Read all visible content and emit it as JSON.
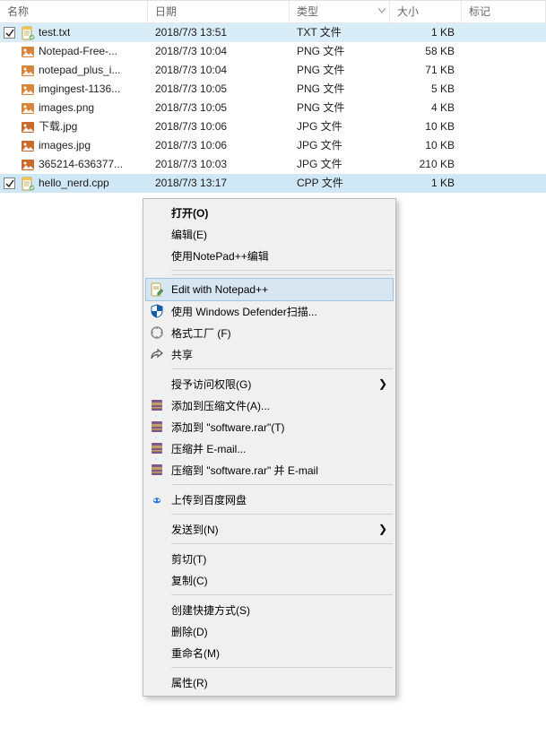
{
  "header": {
    "columns": {
      "name": "名称",
      "date": "日期",
      "type": "类型",
      "size": "大小",
      "tags": "标记"
    }
  },
  "files": [
    {
      "selected": true,
      "icon": "txt",
      "name": "test.txt",
      "date": "2018/7/3 13:51",
      "type": "TXT 文件",
      "size": "1 KB"
    },
    {
      "selected": false,
      "icon": "png",
      "name": "Notepad-Free-...",
      "date": "2018/7/3 10:04",
      "type": "PNG 文件",
      "size": "58 KB"
    },
    {
      "selected": false,
      "icon": "png",
      "name": "notepad_plus_i...",
      "date": "2018/7/3 10:04",
      "type": "PNG 文件",
      "size": "71 KB"
    },
    {
      "selected": false,
      "icon": "png",
      "name": "imgingest-1136...",
      "date": "2018/7/3 10:05",
      "type": "PNG 文件",
      "size": "5 KB"
    },
    {
      "selected": false,
      "icon": "png",
      "name": "images.png",
      "date": "2018/7/3 10:05",
      "type": "PNG 文件",
      "size": "4 KB"
    },
    {
      "selected": false,
      "icon": "jpg",
      "name": "下载.jpg",
      "date": "2018/7/3 10:06",
      "type": "JPG 文件",
      "size": "10 KB"
    },
    {
      "selected": false,
      "icon": "jpg",
      "name": "images.jpg",
      "date": "2018/7/3 10:06",
      "type": "JPG 文件",
      "size": "10 KB"
    },
    {
      "selected": false,
      "icon": "jpg",
      "name": "365214-636377...",
      "date": "2018/7/3 10:03",
      "type": "JPG 文件",
      "size": "210 KB"
    },
    {
      "selected": true,
      "icon": "cpp",
      "name": "hello_nerd.cpp",
      "date": "2018/7/3 13:17",
      "type": "CPP 文件",
      "size": "1 KB"
    }
  ],
  "context_menu": {
    "items": [
      {
        "kind": "item",
        "icon": "none",
        "label": "打开(O)",
        "default": true
      },
      {
        "kind": "item",
        "icon": "none",
        "label": "编辑(E)"
      },
      {
        "kind": "item",
        "icon": "none",
        "label": "使用NotePad++编辑"
      },
      {
        "kind": "sep"
      },
      {
        "kind": "sep"
      },
      {
        "kind": "item",
        "icon": "npp",
        "label": "Edit with Notepad++",
        "highlight": true
      },
      {
        "kind": "item",
        "icon": "defender",
        "label": "使用 Windows Defender扫描..."
      },
      {
        "kind": "item",
        "icon": "format",
        "label": "格式工厂 (F)"
      },
      {
        "kind": "item",
        "icon": "share",
        "label": "共享"
      },
      {
        "kind": "sep"
      },
      {
        "kind": "item",
        "icon": "none",
        "label": "授予访问权限(G)",
        "submenu": true
      },
      {
        "kind": "item",
        "icon": "rar",
        "label": "添加到压缩文件(A)..."
      },
      {
        "kind": "item",
        "icon": "rar",
        "label": "添加到 \"software.rar\"(T)"
      },
      {
        "kind": "item",
        "icon": "rar",
        "label": "压缩并 E-mail..."
      },
      {
        "kind": "item",
        "icon": "rar",
        "label": "压缩到 \"software.rar\" 并 E-mail"
      },
      {
        "kind": "sep"
      },
      {
        "kind": "item",
        "icon": "baidu",
        "label": "上传到百度网盘"
      },
      {
        "kind": "sep"
      },
      {
        "kind": "item",
        "icon": "none",
        "label": "发送到(N)",
        "submenu": true
      },
      {
        "kind": "sep"
      },
      {
        "kind": "item",
        "icon": "none",
        "label": "剪切(T)"
      },
      {
        "kind": "item",
        "icon": "none",
        "label": "复制(C)"
      },
      {
        "kind": "sep"
      },
      {
        "kind": "item",
        "icon": "none",
        "label": "创建快捷方式(S)"
      },
      {
        "kind": "item",
        "icon": "none",
        "label": "删除(D)"
      },
      {
        "kind": "item",
        "icon": "none",
        "label": "重命名(M)"
      },
      {
        "kind": "sep"
      },
      {
        "kind": "item",
        "icon": "none",
        "label": "属性(R)"
      }
    ]
  },
  "icon_colors": {
    "txt_accent": "#f0c34a",
    "png_bg": "#d7853b",
    "jpg_bg": "#c96a2d",
    "cpp_accent": "#f0c34a",
    "defender_blue": "#0f5fa8",
    "baidu_blue": "#2a7be4",
    "rar_purple": "#7a5a8f",
    "rar_band": "#bfa15a"
  }
}
